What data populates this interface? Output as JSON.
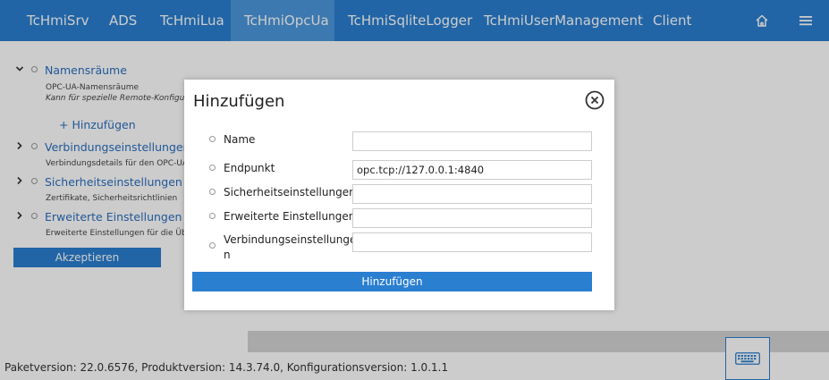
{
  "nav": {
    "tabs": [
      {
        "label": "TcHmiSrv"
      },
      {
        "label": "ADS"
      },
      {
        "label": "TcHmiLua"
      },
      {
        "label": "TcHmiOpcUa"
      },
      {
        "label": "TcHmiSqliteLogger"
      },
      {
        "label": "TcHmiUserManagement"
      },
      {
        "label": "Client"
      }
    ],
    "active_tab": "TcHmiOpcUa",
    "icons": [
      "home-icon",
      "menu-icon"
    ]
  },
  "tree": {
    "namespaces": {
      "title": "Namensräume",
      "desc1": "OPC-UA-Namensräume",
      "desc2": "Kann für spezielle Remote-Konfigura",
      "add_label": "Hinzufügen"
    },
    "connection": {
      "title": "Verbindungseinstellungen",
      "desc": "Verbindungsdetails für den OPC-UA-S"
    },
    "security": {
      "title": "Sicherheitseinstellungen",
      "desc": "Zertifikate, Sicherheitsrichtlinien"
    },
    "advanced": {
      "title": "Erweiterte Einstellungen",
      "desc": "Erweiterte Einstellungen für die Über"
    }
  },
  "accept_button": "Akzeptieren",
  "footer": "Paketversion: 22.0.6576, Produktversion: 14.3.74.0, Konfigurationsversion: 1.0.1.1",
  "modal": {
    "title": "Hinzufügen",
    "fields": [
      {
        "label": "Name",
        "value": ""
      },
      {
        "label": "Endpunkt",
        "value": "opc.tcp://127.0.0.1:4840"
      },
      {
        "label": "Sicherheitseinstellungen",
        "value": ""
      },
      {
        "label": "Erweiterte Einstellungen",
        "value": ""
      },
      {
        "label": "Verbindungseinstellunge",
        "label_cont": "n",
        "value": ""
      }
    ],
    "submit_label": "Hinzufügen"
  },
  "colors": {
    "accent": "#2a7fd0",
    "active_tab": "#4b98dc",
    "link": "#2a6fc0"
  }
}
